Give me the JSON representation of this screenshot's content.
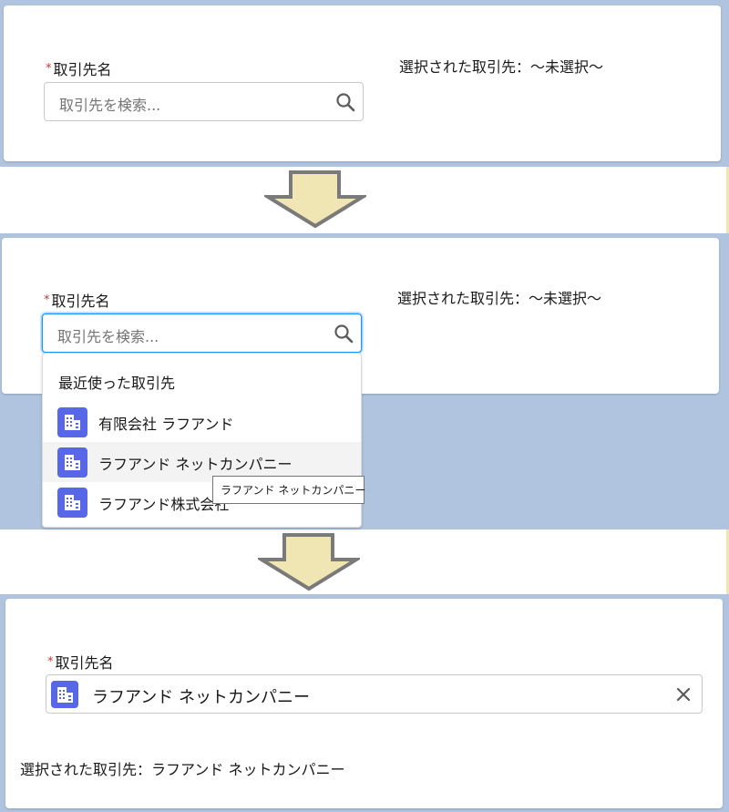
{
  "step1": {
    "field_label": "取引先名",
    "required_mark": "*",
    "search_placeholder": "取引先を検索...",
    "selected_text": "選択された取引先：～未選択～"
  },
  "step2": {
    "field_label": "取引先名",
    "required_mark": "*",
    "search_placeholder": "取引先を検索...",
    "selected_text": "選択された取引先：～未選択～",
    "dropdown": {
      "header": "最近使った取引先",
      "options": [
        {
          "label": "有限会社 ラフアンド",
          "icon": "account-icon"
        },
        {
          "label": "ラフアンド ネットカンパニー",
          "icon": "account-icon"
        },
        {
          "label": "ラフアンド株式会社",
          "icon": "account-icon"
        }
      ]
    },
    "tooltip": "ラフアンド ネットカンパニー"
  },
  "step3": {
    "field_label": "取引先名",
    "required_mark": "*",
    "selected_value": "ラフアンド ネットカンパニー",
    "selected_text": "選択された取引先：ラフアンド ネットカンパニー"
  },
  "colors": {
    "band": "#b0c4df",
    "account_icon": "#5867e8",
    "arrow_fill": "#f0e6b4",
    "arrow_stroke": "#7a7a7a",
    "required": "#c23934",
    "focus": "#1b96ff"
  },
  "icons": {
    "search": "search-icon",
    "account": "account-icon",
    "clear": "close-icon",
    "arrow": "arrow-down-icon"
  }
}
